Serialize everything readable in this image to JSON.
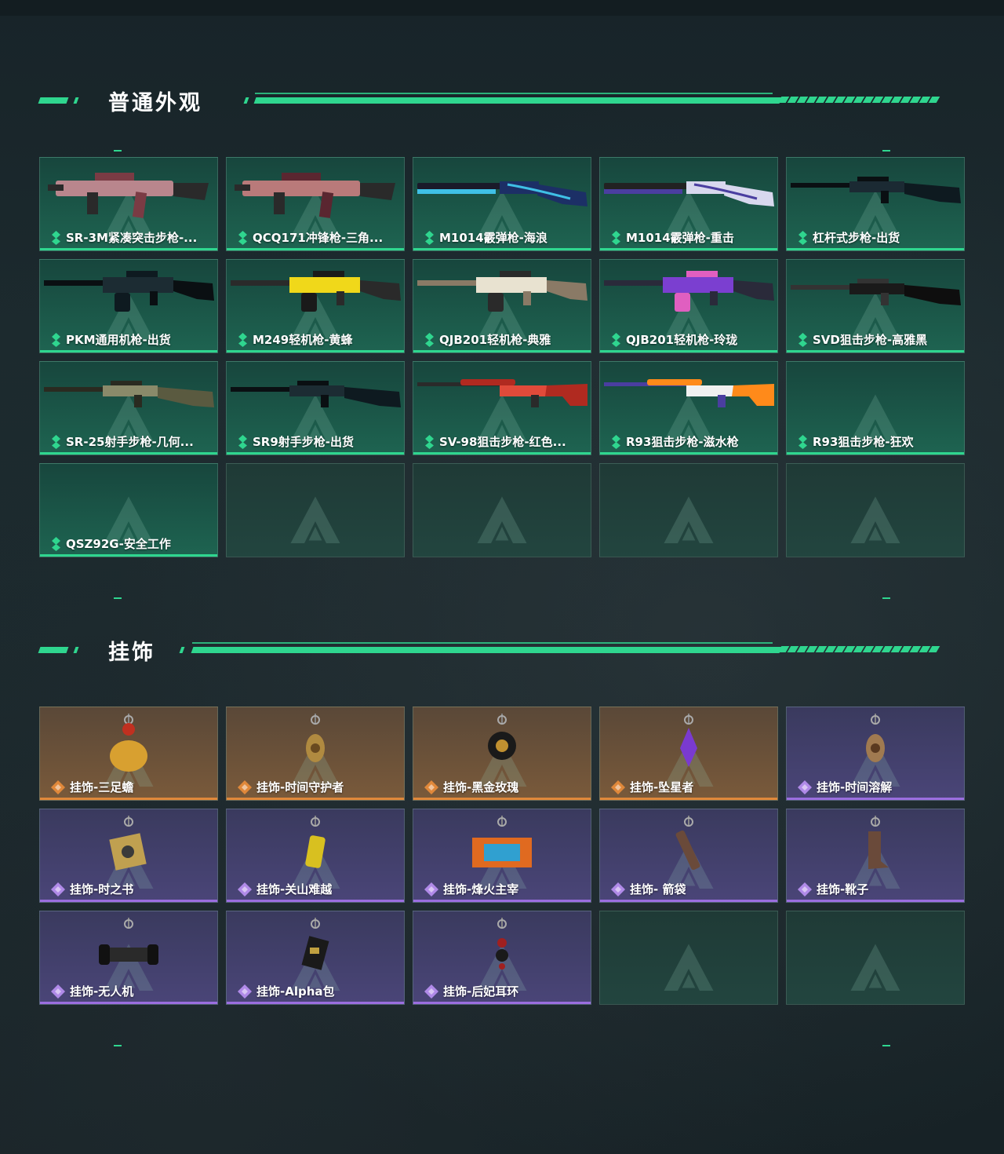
{
  "sections": {
    "skins": {
      "title": "普通外观",
      "items": [
        {
          "label": "SR-3M紧凑突击步枪-...",
          "rarity": "green",
          "gun": "smg",
          "colors": [
            "#b9868d",
            "#7a3b44",
            "#2a2a2a"
          ]
        },
        {
          "label": "QCQ171冲锋枪-三角...",
          "rarity": "green",
          "gun": "smg",
          "colors": [
            "#b97a7a",
            "#5a2630",
            "#2a2a2a"
          ]
        },
        {
          "label": "M1014霰弹枪-海浪",
          "rarity": "green",
          "gun": "shotgun",
          "colors": [
            "#1c2f66",
            "#3fc0e6",
            "#1a1a2a"
          ]
        },
        {
          "label": "M1014霰弹枪-重击",
          "rarity": "green",
          "gun": "shotgun",
          "colors": [
            "#d8d8ee",
            "#4a3ea0",
            "#222"
          ]
        },
        {
          "label": "杠杆式步枪-出货",
          "rarity": "green",
          "gun": "rifle",
          "colors": [
            "#1b2a33",
            "#0e1a20",
            "#0a0f12"
          ]
        },
        {
          "label": "PKM通用机枪-出货",
          "rarity": "green",
          "gun": "lmg",
          "colors": [
            "#1c2c33",
            "#0e1a20",
            "#0a0f12"
          ]
        },
        {
          "label": "M249轻机枪-黄蜂",
          "rarity": "green",
          "gun": "lmg",
          "colors": [
            "#f0d81a",
            "#1a1a1a",
            "#2a2a2a"
          ]
        },
        {
          "label": "QJB201轻机枪-典雅",
          "rarity": "green",
          "gun": "lmg",
          "colors": [
            "#e8e2d0",
            "#2a2a2a",
            "#8a7a66"
          ]
        },
        {
          "label": "QJB201轻机枪-玲珑",
          "rarity": "green",
          "gun": "lmg",
          "colors": [
            "#7b3fd0",
            "#e05fc0",
            "#2a2a3a"
          ]
        },
        {
          "label": "SVD狙击步枪-高雅黑",
          "rarity": "green",
          "gun": "rifle",
          "colors": [
            "#1a1a1a",
            "#0e0e0e",
            "#333"
          ]
        },
        {
          "label": "SR-25射手步枪-几何...",
          "rarity": "green",
          "gun": "rifle",
          "colors": [
            "#8a8a6a",
            "#5a5a40",
            "#2a2a20"
          ]
        },
        {
          "label": "SR9射手步枪-出货",
          "rarity": "green",
          "gun": "rifle",
          "colors": [
            "#1c2c33",
            "#0e1a20",
            "#0a0f12"
          ]
        },
        {
          "label": "SV-98狙击步枪-红色...",
          "rarity": "green",
          "gun": "sniper",
          "colors": [
            "#e04a3a",
            "#b02a20",
            "#2a2a2a"
          ]
        },
        {
          "label": "R93狙击步枪-滋水枪",
          "rarity": "green",
          "gun": "sniper",
          "colors": [
            "#f0f0f0",
            "#ff8a1a",
            "#4a3ea0"
          ]
        },
        {
          "label": "R93狙击步枪-狂欢",
          "rarity": "green",
          "gun": "none",
          "colors": []
        },
        {
          "label": "QSZ92G-安全工作",
          "rarity": "green",
          "gun": "none",
          "colors": []
        },
        {
          "label": "",
          "rarity": "empty",
          "gun": "none",
          "colors": []
        },
        {
          "label": "",
          "rarity": "empty",
          "gun": "none",
          "colors": []
        },
        {
          "label": "",
          "rarity": "empty",
          "gun": "none",
          "colors": []
        },
        {
          "label": "",
          "rarity": "empty",
          "gun": "none",
          "colors": []
        }
      ]
    },
    "charms": {
      "title": "挂饰",
      "items": [
        {
          "label": "挂饰-三足蟾",
          "rarity": "gold",
          "charm": "toad",
          "colors": [
            "#d8a030",
            "#c03020"
          ]
        },
        {
          "label": "挂饰-时间守护者",
          "rarity": "gold",
          "charm": "pendant",
          "colors": [
            "#b08a40",
            "#6a4a20"
          ]
        },
        {
          "label": "挂饰-黑金玫瑰",
          "rarity": "gold",
          "charm": "rose",
          "colors": [
            "#1a1a1a",
            "#c09030"
          ]
        },
        {
          "label": "挂饰-坠星者",
          "rarity": "gold",
          "charm": "crystal",
          "colors": [
            "#7a3ad0",
            "#2a1a4a"
          ]
        },
        {
          "label": "挂饰-时间溶解",
          "rarity": "purple",
          "charm": "pendant",
          "colors": [
            "#a07a50",
            "#5a3a20"
          ]
        },
        {
          "label": "挂饰-时之书",
          "rarity": "purple",
          "charm": "book",
          "colors": [
            "#c0a050",
            "#3a3a3a"
          ]
        },
        {
          "label": "挂饰-关山难越",
          "rarity": "purple",
          "charm": "can",
          "colors": [
            "#d8c020",
            "#8a7a10"
          ]
        },
        {
          "label": "挂饰-烽火主宰",
          "rarity": "purple",
          "charm": "box",
          "colors": [
            "#e06a20",
            "#30a0d0"
          ]
        },
        {
          "label": "挂饰- 箭袋",
          "rarity": "purple",
          "charm": "quiver",
          "colors": [
            "#6a4a3a",
            "#3a2a20"
          ]
        },
        {
          "label": "挂饰-靴子",
          "rarity": "purple",
          "charm": "boot",
          "colors": [
            "#6a4a3a",
            "#3a2a20"
          ]
        },
        {
          "label": "挂饰-无人机",
          "rarity": "purple",
          "charm": "drone",
          "colors": [
            "#2a2a2a",
            "#111"
          ]
        },
        {
          "label": "挂饰-Alpha包",
          "rarity": "purple",
          "charm": "bag",
          "colors": [
            "#1a1a1a",
            "#c0a040"
          ]
        },
        {
          "label": "挂饰-后妃耳环",
          "rarity": "purple",
          "charm": "earring",
          "colors": [
            "#1a1a1a",
            "#a02020"
          ]
        },
        {
          "label": "",
          "rarity": "empty",
          "charm": "none",
          "colors": []
        },
        {
          "label": "",
          "rarity": "empty",
          "charm": "none",
          "colors": []
        }
      ]
    }
  },
  "accent": "#2fd68f",
  "rarity_colors": {
    "green": "#2fd68f",
    "gold": "#e0883a",
    "purple": "#9b6ee0"
  }
}
